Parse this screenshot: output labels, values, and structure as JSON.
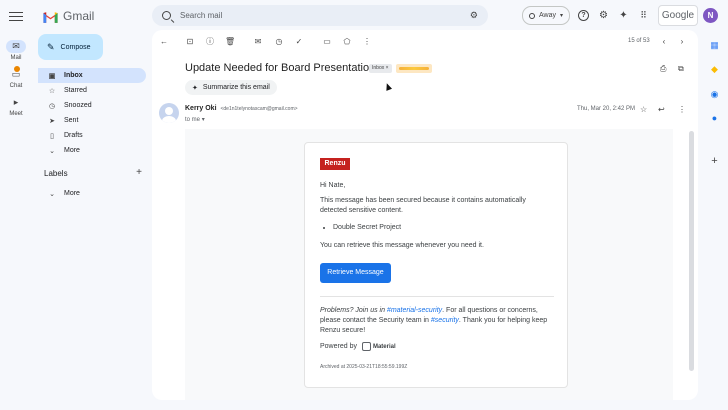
{
  "rail": {
    "items": [
      {
        "label": "Mail"
      },
      {
        "label": "Chat"
      },
      {
        "label": "Meet"
      }
    ]
  },
  "header": {
    "app_name": "Gmail",
    "search_placeholder": "Search mail",
    "status": "Away",
    "google_label": "Google",
    "avatar_initial": "N"
  },
  "sidebar": {
    "compose_label": "Compose",
    "items": [
      {
        "label": "Inbox",
        "icon": "inbox-icon",
        "active": true
      },
      {
        "label": "Starred",
        "icon": "star-icon"
      },
      {
        "label": "Snoozed",
        "icon": "clock-icon"
      },
      {
        "label": "Sent",
        "icon": "send-icon"
      },
      {
        "label": "Drafts",
        "icon": "draft-icon"
      },
      {
        "label": "More",
        "icon": "chevron-down-icon"
      }
    ],
    "labels_heading": "Labels",
    "labels_more": "More"
  },
  "toolbar": {
    "pager": "15 of 53"
  },
  "email": {
    "subject": "Update Needed for Board Presentation",
    "inbox_chip": "Inbox ×",
    "summarize_label": "Summarize this email",
    "sender_name": "Kerry Oki",
    "sender_address": "<de1n1telynotascam@gmail.com>",
    "to_label": "to me",
    "date": "Thu, Mar 20, 2:42 PM"
  },
  "message": {
    "brand": "Renzu",
    "greeting": "Hi Nate,",
    "line1": "This message has been secured because it contains automatically detected sensitive content.",
    "bullet": "Double Secret Project",
    "line2": "You can retrieve this message whenever you need it.",
    "button_label": "Retrieve Message",
    "problems_lead": "Problems? Join us in ",
    "problems_link": "#material-security",
    "problems_mid": ". For all questions or concerns, please contact the Security team in ",
    "security_link": "#security",
    "problems_tail": ". Thank you for helping keep Renzu secure!",
    "powered_by": "Powered by",
    "material_label": "Material",
    "archived": "Archived at 2025-03-21T18:55:59.199Z"
  },
  "colors": {
    "accent": "#1a73e8",
    "brand": "#c5221f",
    "compose": "#c2e7ff",
    "active_nav": "#d3e3fd"
  }
}
